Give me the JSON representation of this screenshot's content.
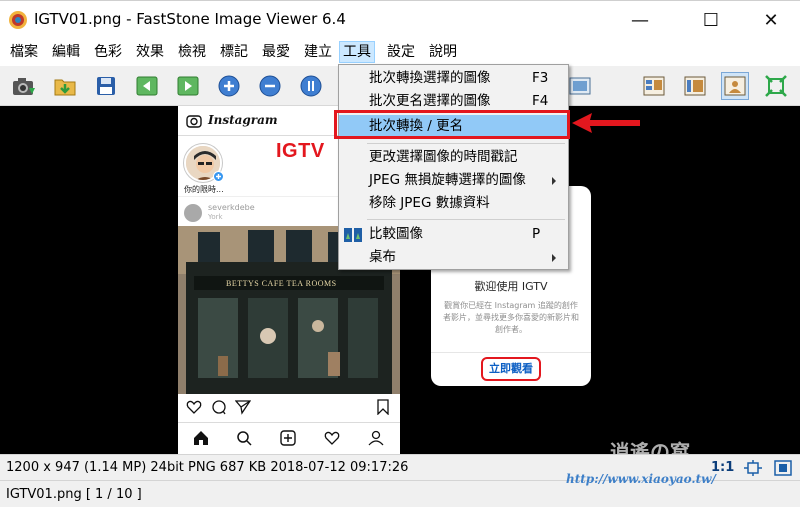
{
  "window": {
    "title": "IGTV01.png  -  FastStone Image Viewer 6.4",
    "minimize_glyph": "—",
    "maximize_glyph": "☐",
    "close_glyph": "✕"
  },
  "menubar": {
    "items": [
      {
        "label": "檔案"
      },
      {
        "label": "編輯"
      },
      {
        "label": "色彩"
      },
      {
        "label": "效果"
      },
      {
        "label": "檢視"
      },
      {
        "label": "標記"
      },
      {
        "label": "最愛"
      },
      {
        "label": "建立"
      },
      {
        "label": "工具",
        "active": true
      },
      {
        "label": "設定"
      },
      {
        "label": "說明"
      }
    ]
  },
  "toolbar": {
    "buttons": [
      {
        "icon": "camera-icon"
      },
      {
        "icon": "open-folder-icon"
      },
      {
        "icon": "save-icon"
      },
      {
        "icon": "previous-icon"
      },
      {
        "icon": "next-icon"
      },
      {
        "icon": "zoom-in-icon"
      },
      {
        "icon": "zoom-out-icon"
      },
      {
        "icon": "actual-size-icon"
      },
      {
        "icon": "dropdown-overlap-icon"
      },
      {
        "icon": "layout-icon"
      },
      {
        "icon": "browser-icon"
      },
      {
        "icon": "fullscreen-view-icon"
      },
      {
        "icon": "fit-window-icon"
      }
    ]
  },
  "tools_menu": {
    "items": [
      {
        "label": "批次轉換選擇的圖像",
        "shortcut": "F3"
      },
      {
        "label": "批次更名選擇的圖像",
        "shortcut": "F4"
      },
      {
        "label": "批次轉換 / 更名",
        "shortcut": "",
        "highlighted": true
      },
      {
        "label": "更改選擇圖像的時間戳記",
        "shortcut": ""
      },
      {
        "label": "JPEG 無損旋轉選擇的圖像",
        "shortcut": "",
        "submenu": true
      },
      {
        "label": "移除 JPEG 數據資料",
        "shortcut": ""
      },
      {
        "label": "比較圖像",
        "shortcut": "P",
        "icon": "compare-icon"
      },
      {
        "label": "桌布",
        "shortcut": "",
        "submenu": true
      }
    ]
  },
  "image": {
    "instagram": {
      "logo_text": "Instagram",
      "overlay_label": "IGTV",
      "story_label": "你的限時...",
      "post_user": "severkdebe",
      "post_location": "York",
      "shop_sign": "BETTYS CAFE TEA ROOMS"
    },
    "welcome_card": {
      "title": "歡迎使用 IGTV",
      "description": "觀賞你已經在 Instagram 追蹤的創作者影片，並尋找更多你喜愛的新影片和創作者。",
      "button_label": "立即觀看"
    },
    "watermark_logo": "逍遙の窩",
    "watermark_url": "http://www.xiaoyao.tw/"
  },
  "status": {
    "info": "1200 x 947 (1.14 MP)   24bit  PNG    687 KB    2018-07-12 09:17:26",
    "zoom": "1:1",
    "file": "IGTV01.png [ 1 / 10 ]"
  },
  "colors": {
    "highlight_red": "#e3171e",
    "menu_highlight": "#91c9f7",
    "link_blue": "#0c5fc4"
  }
}
